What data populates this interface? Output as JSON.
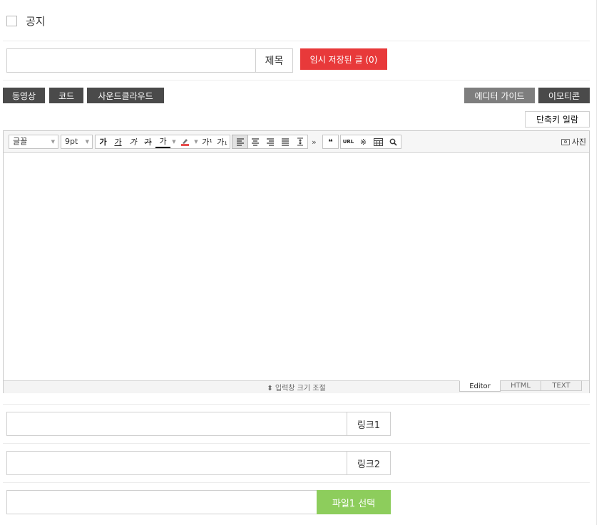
{
  "notice": {
    "label": "공지",
    "checked": false
  },
  "title": {
    "value": "",
    "label": "제목"
  },
  "draft_button": "임시 저장된 글 (0)",
  "media_buttons": [
    "동영상",
    "코드",
    "사운드클라우드"
  ],
  "right_buttons": {
    "editor_guide": "에디터 가이드",
    "emoticon": "이모티콘"
  },
  "shortcut_button": "단축키 일람",
  "toolbar": {
    "font_select": "글꼴",
    "size_select": "9pt",
    "format_buttons": [
      "가",
      "가",
      "가",
      "가",
      "가"
    ],
    "script_buttons": [
      "가¹",
      "가₁"
    ],
    "quote": "❝",
    "more": "»",
    "url": "URL",
    "special_char": "※",
    "photo": "사진"
  },
  "resize_label": "입력창 크기 조절",
  "mode_tabs": [
    "Editor",
    "HTML",
    "TEXT"
  ],
  "link1": {
    "value": "",
    "label": "링크1"
  },
  "link2": {
    "value": "",
    "label": "링크2"
  },
  "file1": {
    "value": "",
    "button": "파일1 선택"
  },
  "colors": {
    "draft": "#e8393a",
    "dark_button": "#4a4a4a",
    "gray_button": "#7e7e7e",
    "file_button": "#8dcd5c"
  }
}
